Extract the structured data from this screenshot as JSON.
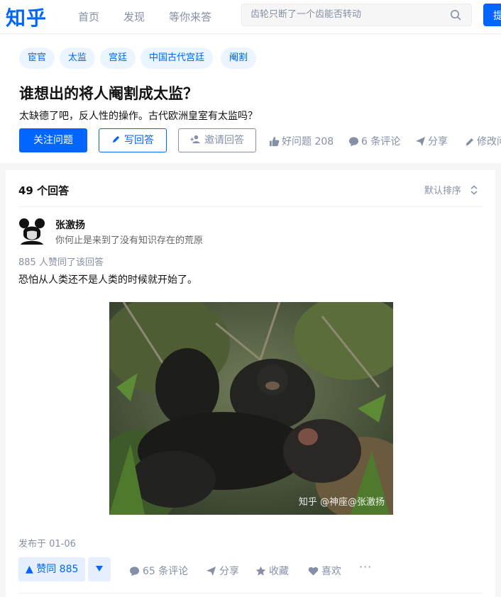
{
  "nav": {
    "logo": "知乎",
    "links": [
      "首页",
      "发现",
      "等你来答"
    ],
    "search_placeholder": "齿轮只断了一个齿能否转动",
    "ask_label": "提问"
  },
  "question": {
    "tags": [
      "宦官",
      "太监",
      "宫廷",
      "中国古代宫廷",
      "阉割"
    ],
    "title": "谁想出的将人阉割成太监？",
    "detail": "太缺德了吧，反人性的操作。古代欧洲皇室有太监吗？",
    "follow_label": "关注问题",
    "write_label": "写回答",
    "invite_label": "邀请回答",
    "good_question": "好问题 208",
    "comments": "6 条评论",
    "share": "分享",
    "edit": "修改问题"
  },
  "answers": {
    "count_label": "49 个回答",
    "sort_label": "默认排序",
    "first": {
      "author": "张激扬",
      "bio": "你何止是来到了没有知识存在的荒原",
      "votes_line": "885 人赞同了该回答",
      "content": "恐怕从人类还不是人类的时候就开始了。",
      "image_watermark": "知乎 @神座@张激扬",
      "published": "发布于 01-06",
      "vote_label": "▲ 赞同 885",
      "comments": "65 条评论",
      "share": "分享",
      "collect": "收藏",
      "like": "喜欢",
      "more": "···"
    }
  },
  "colors": {
    "brand": "#0066ff",
    "muted": "#8590a6",
    "tag_bg": "#ebf5ff"
  }
}
